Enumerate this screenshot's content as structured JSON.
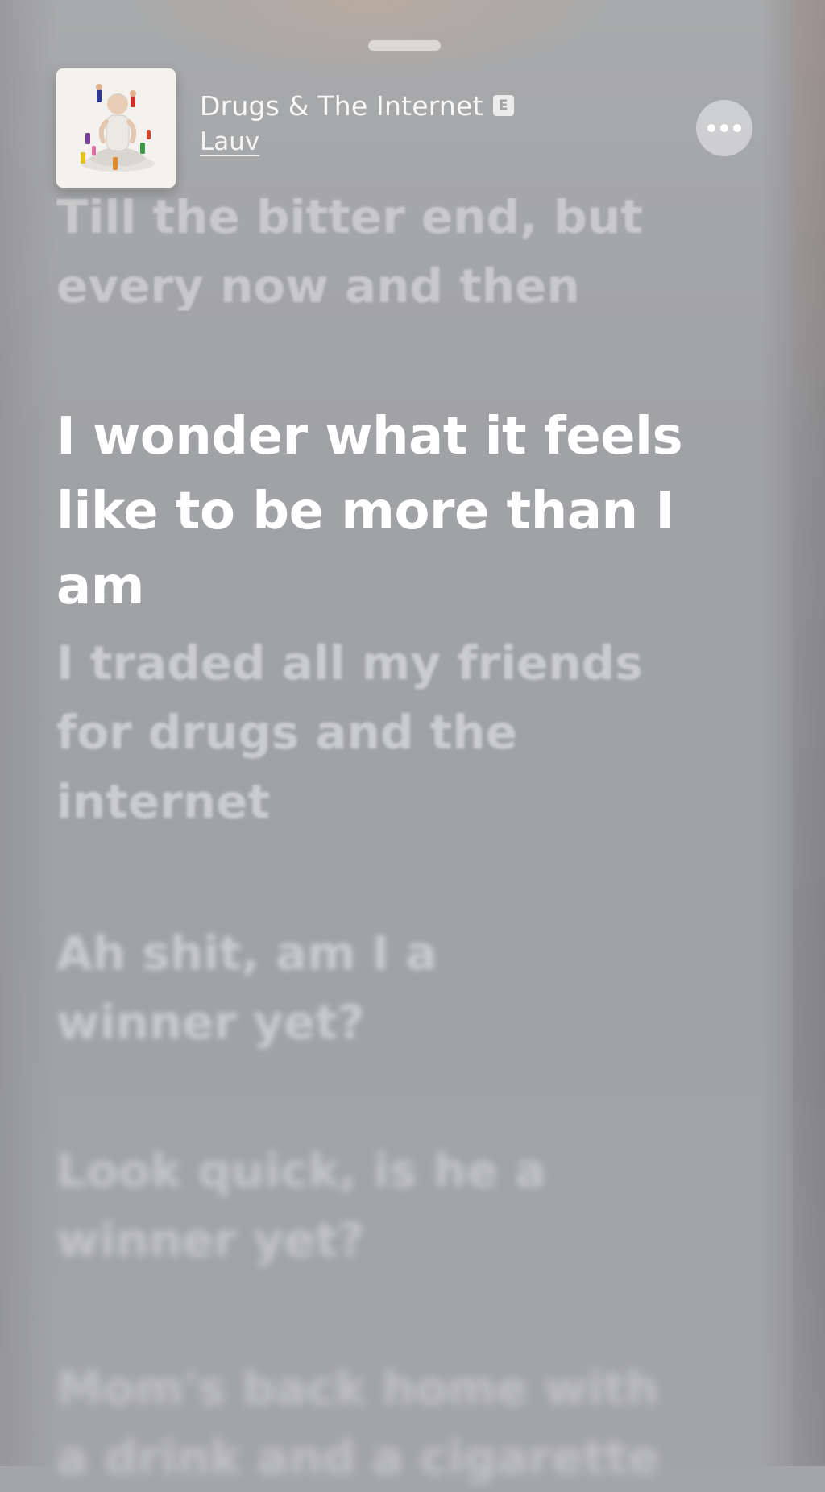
{
  "now_playing": {
    "title": "Drugs & The Internet",
    "explicit_badge": "E",
    "artist": "Lauv",
    "more_icon": "ellipsis-icon"
  },
  "lyrics": {
    "previous": "Till the bitter end, but\nevery now and then",
    "current": "I wonder what it feels\nlike to be more than I am",
    "upcoming": [
      "I traded all my friends\nfor drugs and the\ninternet",
      "Ah shit, am I a\nwinner yet?",
      "Look quick, is he a\nwinner yet?",
      "Mom's back home with\na drink and a cigarette"
    ]
  },
  "colors": {
    "background": "#a3a5a9",
    "active_lyric": "#ffffff"
  }
}
